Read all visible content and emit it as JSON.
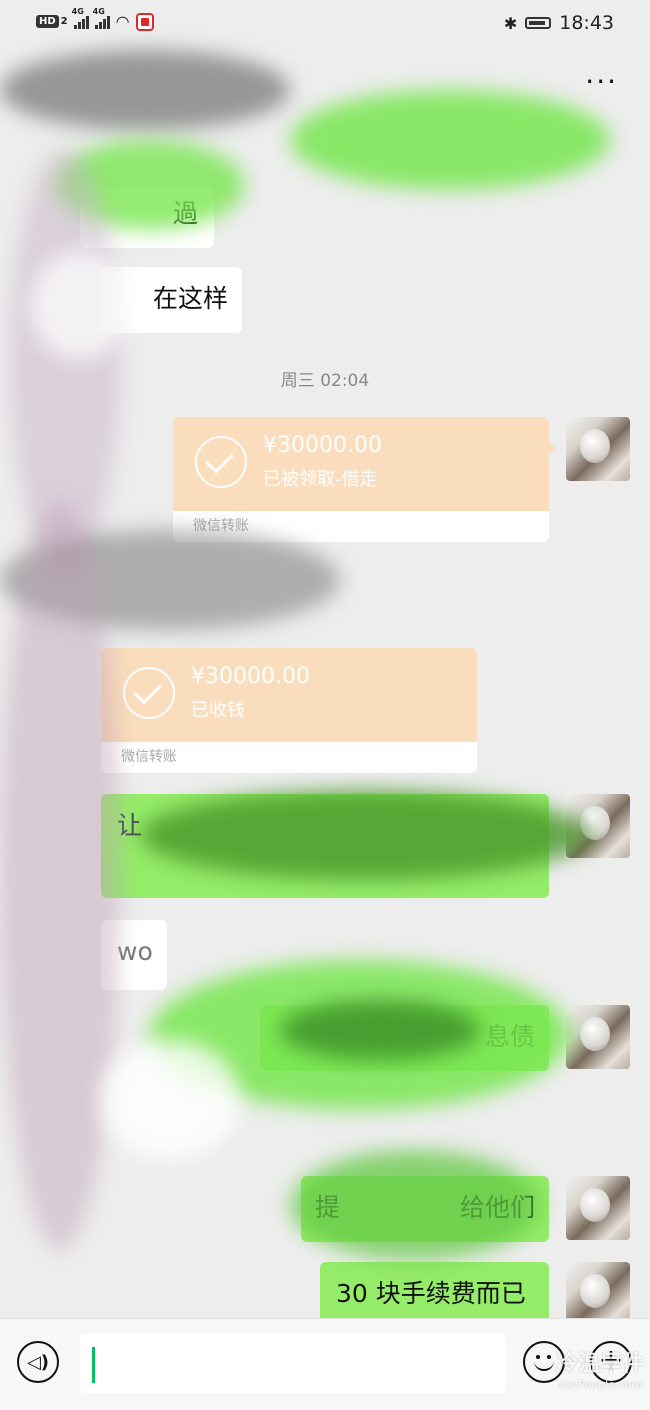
{
  "statusbar": {
    "hd": "HD",
    "hd_sub": "2",
    "sig1": "4G",
    "sig2": "4G",
    "time": "18:43"
  },
  "header": {
    "more_icon": "more-dots-icon",
    "more_label": "···"
  },
  "messages": {
    "m1_text": "在这样",
    "m1_partial": "過",
    "timestamp": "周三 02:04",
    "transfer1": {
      "amount": "¥30000.00",
      "status": "已被领取-借走",
      "footer": "微信转账"
    },
    "transfer2": {
      "amount": "¥30000.00",
      "status": "已收钱",
      "footer": "微信转账"
    },
    "green1_partial": "让",
    "white_partial": "wo",
    "green2_partial": "息债",
    "green3_a": "提",
    "green3_b": "给他们",
    "green4": "30 块手续费而已"
  },
  "input": {
    "voice_icon": "voice-icon",
    "emoji_icon": "emoji-icon",
    "plus_icon": "plus-icon",
    "plus_label": "+",
    "voice_label": "◁)"
  },
  "watermark": {
    "text": "冷温早件",
    "sub": "VanPeople.com"
  }
}
